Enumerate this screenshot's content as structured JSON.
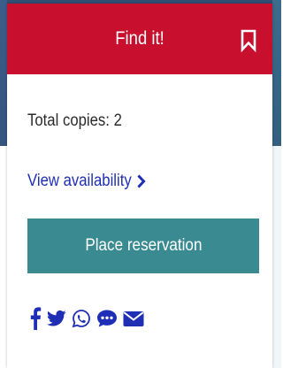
{
  "header": {
    "title": "Find it!",
    "bookmark_icon": "bookmark-icon"
  },
  "holdings": {
    "total_copies": "Total copies: 2",
    "view_availability": "View availability",
    "chevron_icon": "chevron-right-icon"
  },
  "actions": {
    "place_reservation": "Place reservation"
  },
  "share": {
    "icons": [
      "facebook-icon",
      "twitter-icon",
      "whatsapp-icon",
      "sms-icon",
      "email-icon"
    ]
  },
  "colors": {
    "header_bg": "#c8102e",
    "button_bg": "#3a8a92",
    "link": "#1f2fb5",
    "share_icons": "#1f2fb5"
  }
}
